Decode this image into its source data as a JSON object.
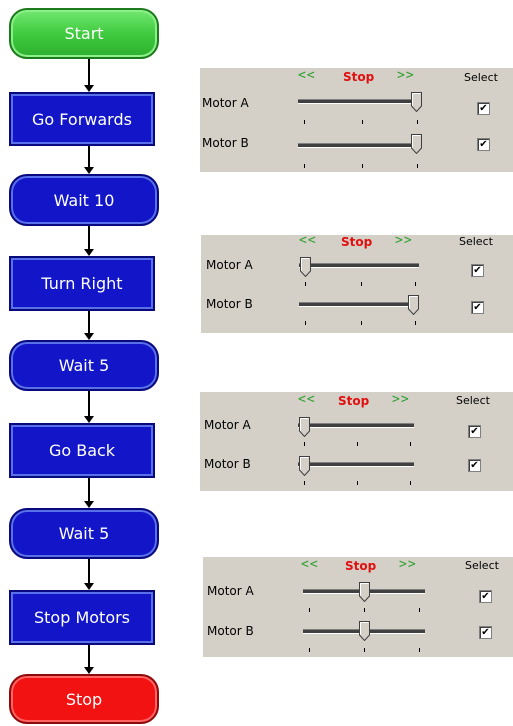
{
  "flowchart": {
    "nodes": [
      {
        "label": "Start"
      },
      {
        "label": "Go Forwards"
      },
      {
        "label": "Wait 10"
      },
      {
        "label": "Turn Right"
      },
      {
        "label": "Wait 5"
      },
      {
        "label": "Go Back"
      },
      {
        "label": "Wait 5"
      },
      {
        "label": "Stop Motors"
      },
      {
        "label": "Stop"
      }
    ]
  },
  "panels": [
    {
      "left_arrows": "<<",
      "stop_text": "Stop",
      "right_arrows": ">>",
      "select_label": "Select",
      "motors": [
        {
          "label": "Motor A",
          "level": 1.0,
          "checked": true
        },
        {
          "label": "Motor B",
          "level": 1.0,
          "checked": true
        }
      ]
    },
    {
      "left_arrows": "<<",
      "stop_text": "Stop",
      "right_arrows": ">>",
      "select_label": "Select",
      "motors": [
        {
          "label": "Motor A",
          "level": 0.0,
          "checked": true
        },
        {
          "label": "Motor B",
          "level": 1.0,
          "checked": true
        }
      ]
    },
    {
      "left_arrows": "<<",
      "stop_text": "Stop",
      "right_arrows": ">>",
      "select_label": "Select",
      "motors": [
        {
          "label": "Motor A",
          "level": 0.0,
          "checked": true
        },
        {
          "label": "Motor B",
          "level": 0.0,
          "checked": true
        }
      ]
    },
    {
      "left_arrows": "<<",
      "stop_text": "Stop",
      "right_arrows": ">>",
      "select_label": "Select",
      "motors": [
        {
          "label": "Motor A",
          "level": 0.5,
          "checked": true
        },
        {
          "label": "Motor B",
          "level": 0.5,
          "checked": true
        }
      ]
    }
  ],
  "colors": {
    "start_node": "#3cc83c",
    "action_node": "#1216c8",
    "stop_node": "#f31212",
    "panel_background": "#d4d0c8",
    "arrow_text": "#2fa02f",
    "stop_text": "#e01010"
  },
  "icons": {
    "connector": "down-arrow-icon",
    "slider_thumb": "slider-thumb-icon",
    "checkbox": "checkmark-icon"
  }
}
